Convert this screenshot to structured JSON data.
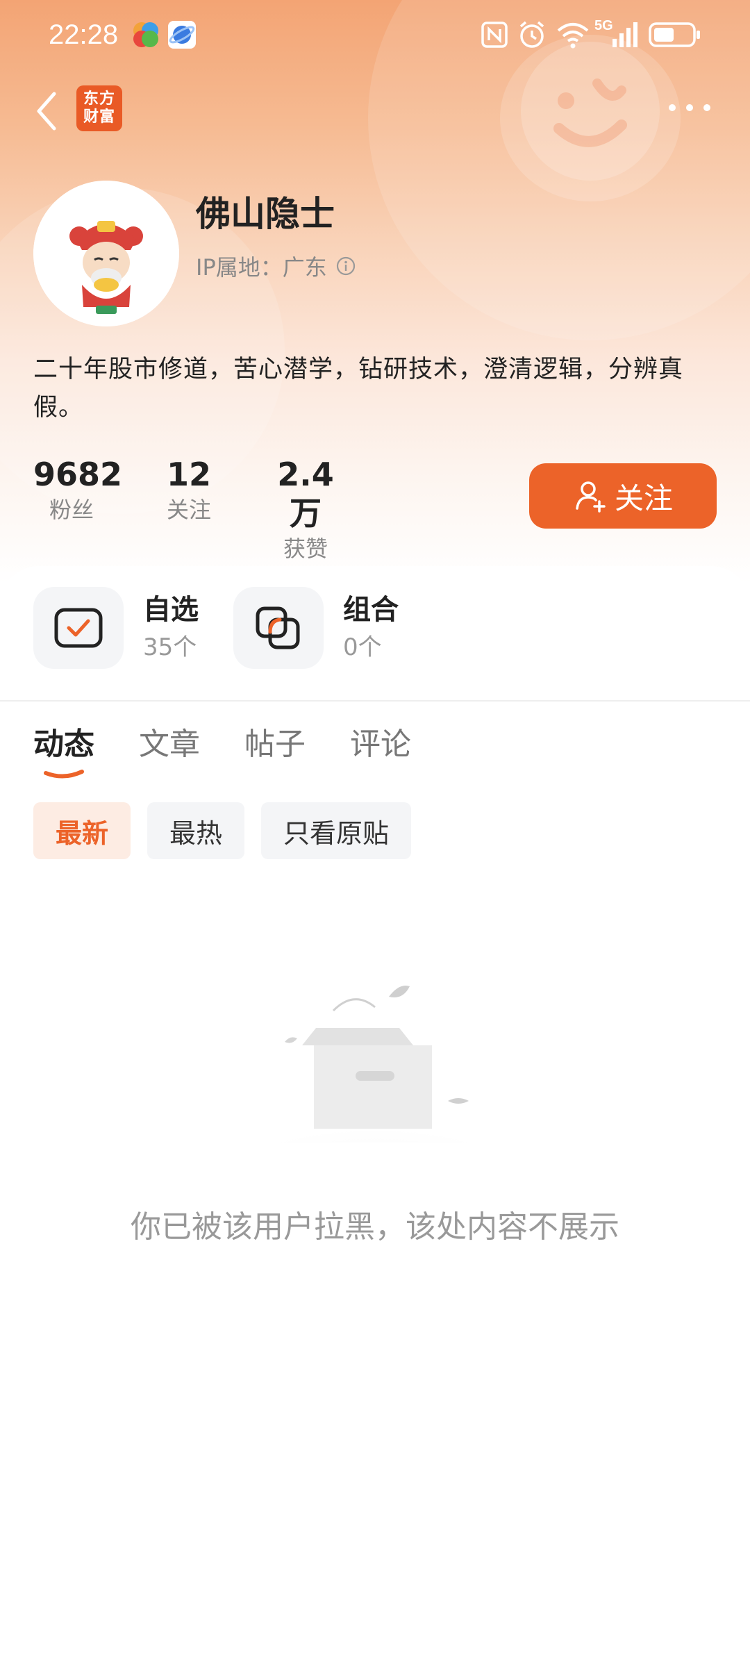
{
  "status_bar": {
    "time": "22:28",
    "network": "5G",
    "icons": [
      "nfc-icon",
      "alarm-icon",
      "wifi-icon",
      "signal-icon",
      "battery-icon"
    ]
  },
  "nav": {
    "logo_line1": "东方",
    "logo_line2": "财富",
    "brand_color": "#e95a26"
  },
  "profile": {
    "name": "佛山隐士",
    "ip_location": "IP属地：广东",
    "bio": "二十年股市修道，苦心潜学，钻研技术，澄清逻辑，分辨真假。"
  },
  "stats": [
    {
      "value": "9682",
      "label": "粉丝"
    },
    {
      "value": "12",
      "label": "关注"
    },
    {
      "value": "2.4万",
      "label": "获赞"
    }
  ],
  "follow_button": {
    "label": "关注",
    "color": "#ec6329"
  },
  "portfolio": [
    {
      "title": "自选",
      "count": "35个"
    },
    {
      "title": "组合",
      "count": "0个"
    }
  ],
  "tabs": [
    {
      "label": "动态",
      "active": true
    },
    {
      "label": "文章",
      "active": false
    },
    {
      "label": "帖子",
      "active": false
    },
    {
      "label": "评论",
      "active": false
    }
  ],
  "filters": [
    {
      "label": "最新",
      "active": true
    },
    {
      "label": "最热",
      "active": false
    },
    {
      "label": "只看原贴",
      "active": false
    }
  ],
  "empty_state": {
    "message": "你已被该用户拉黑，该处内容不展示",
    "icon": "empty-box-icon"
  }
}
